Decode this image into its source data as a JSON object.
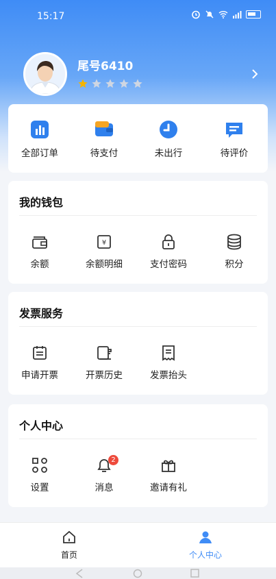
{
  "status_bar": {
    "time": "15:17"
  },
  "profile": {
    "name": "尾号6410",
    "rating": 1,
    "rating_max": 5
  },
  "orders": {
    "items": [
      {
        "label": "全部订单",
        "icon": "chart-icon"
      },
      {
        "label": "待支付",
        "icon": "wallet-card-icon"
      },
      {
        "label": "未出行",
        "icon": "clock-icon"
      },
      {
        "label": "待评价",
        "icon": "comment-icon"
      }
    ]
  },
  "wallet": {
    "title": "我的钱包",
    "items": [
      {
        "label": "余额",
        "icon": "wallet-icon"
      },
      {
        "label": "余额明细",
        "icon": "yen-note-icon"
      },
      {
        "label": "支付密码",
        "icon": "lock-icon"
      },
      {
        "label": "积分",
        "icon": "coin-stack-icon"
      }
    ]
  },
  "invoice": {
    "title": "发票服务",
    "items": [
      {
        "label": "申请开票",
        "icon": "calendar-list-icon"
      },
      {
        "label": "开票历史",
        "icon": "document-history-icon"
      },
      {
        "label": "发票抬头",
        "icon": "receipt-icon"
      }
    ]
  },
  "personal": {
    "title": "个人中心",
    "items": [
      {
        "label": "设置",
        "icon": "settings-grid-icon"
      },
      {
        "label": "消息",
        "icon": "bell-icon",
        "badge": "2"
      },
      {
        "label": "邀请有礼",
        "icon": "gift-icon"
      }
    ]
  },
  "tabs": [
    {
      "label": "首页",
      "icon": "home-icon",
      "active": false
    },
    {
      "label": "个人中心",
      "icon": "user-icon",
      "active": true
    }
  ],
  "colors": {
    "accent": "#3f8cf6",
    "star_active": "#f4b400",
    "star_inactive": "#cfd6e2",
    "badge": "#ee4a3c"
  }
}
